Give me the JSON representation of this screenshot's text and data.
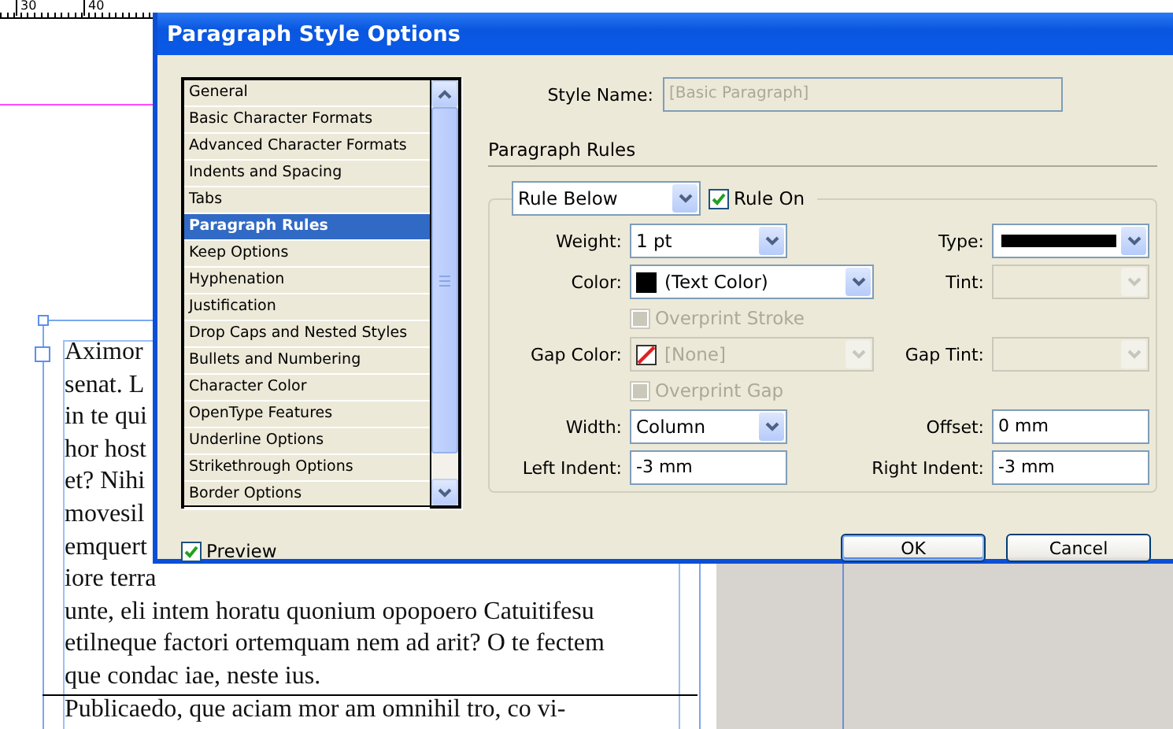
{
  "document": {
    "ruler_labels": [
      "30",
      "40"
    ],
    "text_lines": [
      "Aximor",
      "senat. L",
      "in te qui",
      "hor host",
      "et? Nihi",
      "movesil",
      "emquert",
      "iore terra",
      "unte, eli intem horatu quonium opopoero Catuitifesu",
      "etilneque factori ortemquam nem ad arit? O te fectem",
      "que condac iae, neste ius.",
      "Publicaedo, que aciam mor am omnihil tro, co vi-"
    ]
  },
  "dialog": {
    "title": "Paragraph Style Options",
    "categories": [
      {
        "label": "General",
        "selected": false
      },
      {
        "label": "Basic Character Formats",
        "selected": false
      },
      {
        "label": "Advanced Character Formats",
        "selected": false
      },
      {
        "label": "Indents and Spacing",
        "selected": false
      },
      {
        "label": "Tabs",
        "selected": false
      },
      {
        "label": "Paragraph Rules",
        "selected": true
      },
      {
        "label": "Keep Options",
        "selected": false
      },
      {
        "label": "Hyphenation",
        "selected": false
      },
      {
        "label": "Justification",
        "selected": false
      },
      {
        "label": "Drop Caps and Nested Styles",
        "selected": false
      },
      {
        "label": "Bullets and Numbering",
        "selected": false
      },
      {
        "label": "Character Color",
        "selected": false
      },
      {
        "label": "OpenType Features",
        "selected": false
      },
      {
        "label": "Underline Options",
        "selected": false
      },
      {
        "label": "Strikethrough Options",
        "selected": false
      },
      {
        "label": "Border Options",
        "selected": false
      }
    ],
    "style_name": {
      "label": "Style Name:",
      "value": "[Basic Paragraph]",
      "disabled": true
    },
    "section_title": "Paragraph Rules",
    "rule_select": {
      "value": "Rule Below"
    },
    "rule_on": {
      "label": "Rule On",
      "checked": true,
      "disabled": false
    },
    "rows": [
      {
        "left": {
          "label": "Weight:",
          "kind": "dropdown",
          "value": "1 pt",
          "disabled": false
        },
        "right": {
          "label": "Type:",
          "kind": "line-dropdown",
          "disabled": false
        }
      },
      {
        "left": {
          "label": "Color:",
          "kind": "color-dropdown",
          "value": "(Text Color)",
          "color": "#000000",
          "disabled": false
        },
        "right": {
          "label": "Tint:",
          "kind": "dropdown",
          "disabled": true
        }
      },
      {
        "left": {
          "label": "Overprint Stroke",
          "kind": "checkbox",
          "checked": false,
          "disabled": true
        }
      },
      {
        "left": {
          "label": "Gap Color:",
          "kind": "color-dropdown",
          "value": "[None]",
          "no_color": true,
          "disabled": true
        },
        "right": {
          "label": "Gap Tint:",
          "kind": "dropdown",
          "disabled": true
        }
      },
      {
        "left": {
          "label": "Overprint Gap",
          "kind": "checkbox",
          "checked": false,
          "disabled": true
        }
      },
      {
        "left": {
          "label": "Width:",
          "kind": "dropdown",
          "value": "Column",
          "disabled": false
        },
        "right": {
          "label": "Offset:",
          "kind": "text",
          "value": "0 mm",
          "disabled": false
        }
      },
      {
        "left": {
          "label": "Left Indent:",
          "kind": "text",
          "value": "-3 mm",
          "disabled": false
        },
        "right": {
          "label": "Right Indent:",
          "kind": "text",
          "value": "-3 mm",
          "disabled": false
        }
      }
    ],
    "preview": {
      "label": "Preview",
      "checked": true,
      "disabled": false
    },
    "buttons": [
      {
        "label": "OK",
        "default": true
      },
      {
        "label": "Cancel",
        "default": false
      }
    ]
  }
}
